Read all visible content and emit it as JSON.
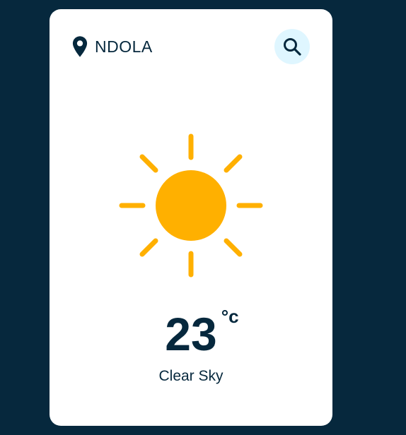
{
  "location": {
    "name": "NDOLA",
    "icon": "map-pin-icon"
  },
  "search": {
    "icon": "search-icon"
  },
  "weather": {
    "icon": "sun-icon",
    "temperature": "23",
    "unit": "°c",
    "description": "Clear Sky"
  },
  "colors": {
    "background": "#06283D",
    "card": "#FFFFFF",
    "accent": "#FFB000",
    "search_bg": "#DFF6FF"
  }
}
